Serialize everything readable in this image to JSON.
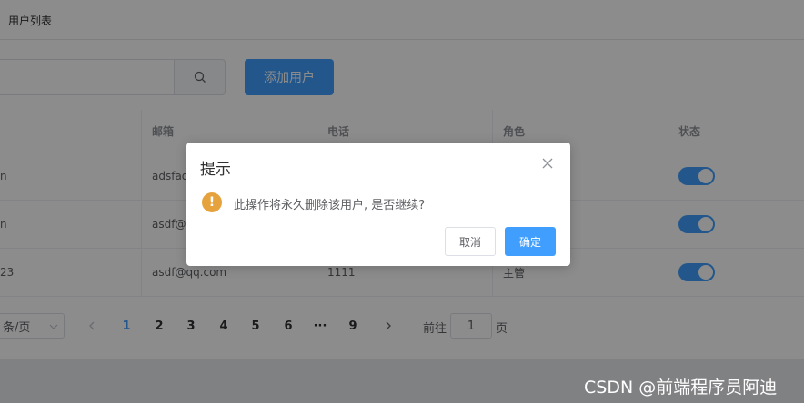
{
  "header": {
    "breadcrumb": "用户列表"
  },
  "toolbar": {
    "search_placeholder": "",
    "add_label": "添加用户"
  },
  "table": {
    "columns": [
      "",
      "邮箱",
      "电话",
      "角色",
      "状态"
    ],
    "rows": [
      {
        "name": "n",
        "email": "adsfad",
        "phone": "",
        "role": "",
        "status_on": true
      },
      {
        "name": "n",
        "email": "asdf@c",
        "phone": "",
        "role": "",
        "status_on": true
      },
      {
        "name": "23",
        "email": "asdf@qq.com",
        "phone": "1111",
        "role": "主管",
        "status_on": true
      }
    ]
  },
  "pagination": {
    "size_label": "条/页",
    "pages": [
      "1",
      "2",
      "3",
      "4",
      "5",
      "6",
      "···",
      "9"
    ],
    "current": "1",
    "goto_label": "前往",
    "goto_value": "1",
    "goto_unit": "页"
  },
  "dialog": {
    "title": "提示",
    "message": "此操作将永久删除该用户, 是否继续?",
    "cancel_label": "取消",
    "confirm_label": "确定",
    "warning_glyph": "!"
  },
  "watermark": "CSDN @前端程序员阿迪",
  "colors": {
    "primary": "#409eff",
    "warning": "#e6a23c"
  }
}
